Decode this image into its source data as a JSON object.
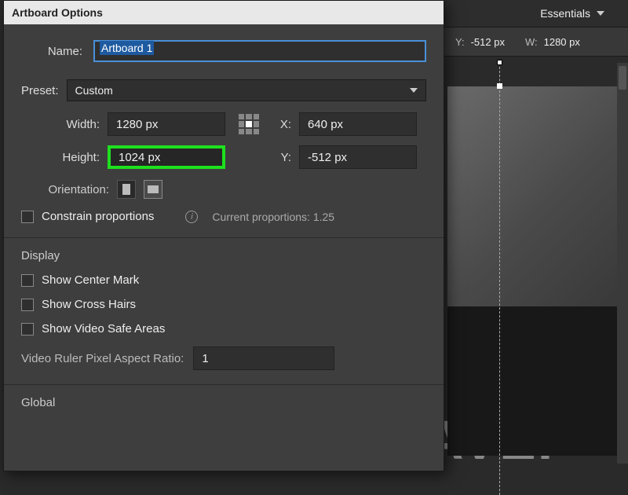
{
  "topbar": {
    "workspace": "Essentials"
  },
  "propbar": {
    "y_label": "Y:",
    "y_value": "-512 px",
    "w_label": "W:",
    "w_value": "1280 px"
  },
  "dialog": {
    "title": "Artboard Options",
    "name_label": "Name:",
    "name_value": "Artboard 1",
    "preset_label": "Preset:",
    "preset_value": "Custom",
    "width_label": "Width:",
    "width_value": "1280 px",
    "height_label": "Height:",
    "height_value": "1024 px",
    "x_label": "X:",
    "x_value": "640 px",
    "y_label": "Y:",
    "y_value": "-512 px",
    "orientation_label": "Orientation:",
    "constrain_label": "Constrain proportions",
    "proportions_label": "Current proportions: 1.25",
    "display_heading": "Display",
    "show_center": "Show Center Mark",
    "show_cross": "Show Cross Hairs",
    "show_safe": "Show Video Safe Areas",
    "vr_label": "Video Ruler Pixel Aspect Ratio:",
    "vr_value": "1",
    "global_heading": "Global"
  },
  "canvas": {
    "big_text": "AVEI"
  }
}
